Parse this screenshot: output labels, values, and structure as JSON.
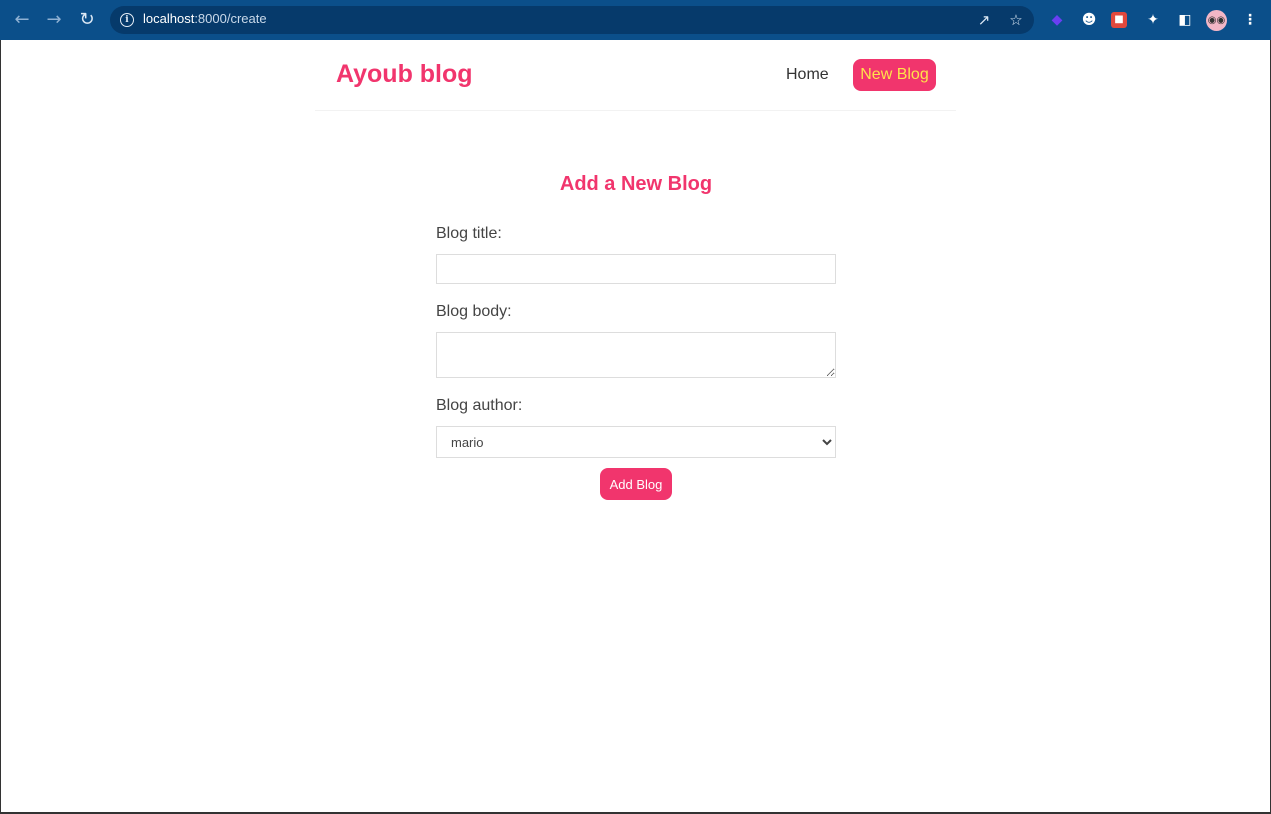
{
  "browser": {
    "url_host": "localhost",
    "url_path": ":8000/create",
    "icons": {
      "back": "arrow-left-icon",
      "forward": "arrow-right-icon",
      "reload": "reload-icon",
      "info": "info-icon",
      "share": "share-icon",
      "bookmark": "star-icon",
      "extensions": "puzzle-icon",
      "sidepanel": "side-panel-icon",
      "menu": "kebab-menu-icon"
    }
  },
  "nav": {
    "brand": "Ayoub blog",
    "home": "Home",
    "new_blog": "New Blog"
  },
  "form": {
    "heading": "Add a New Blog",
    "title_label": "Blog title:",
    "title_value": "",
    "body_label": "Blog body:",
    "body_value": "",
    "author_label": "Blog author:",
    "author_selected": "mario",
    "submit_label": "Add Blog"
  },
  "colors": {
    "brand": "#f1356d",
    "chrome": "#0b4f8a",
    "new_blog_text": "#ffe24a"
  }
}
